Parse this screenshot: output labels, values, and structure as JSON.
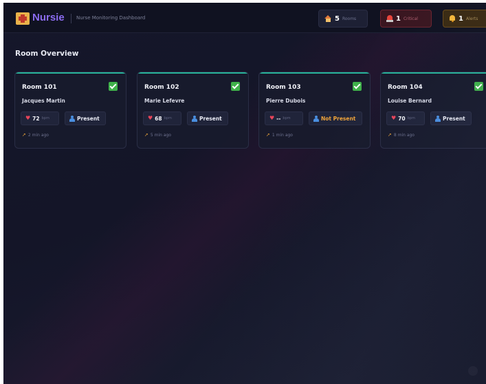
{
  "header": {
    "brand": "Nursie",
    "subtitle": "Nurse Monitoring Dashboard",
    "stats": {
      "rooms": {
        "count": "5",
        "label": "Rooms"
      },
      "critical": {
        "count": "1",
        "label": "Critical"
      },
      "alerts": {
        "count": "1",
        "label": "Alerts"
      }
    }
  },
  "main": {
    "section_title": "Room Overview",
    "rooms": [
      {
        "name": "Room 101",
        "patient": "Jacques Martin",
        "heart_rate": "72",
        "unit": "bpm",
        "presence": "Present",
        "last_seen": "2 min ago"
      },
      {
        "name": "Room 102",
        "patient": "Marie Lefevre",
        "heart_rate": "68",
        "unit": "bpm",
        "presence": "Present",
        "last_seen": "5 min ago"
      },
      {
        "name": "Room 103",
        "patient": "Pierre Dubois",
        "heart_rate": "--",
        "unit": "bpm",
        "presence": "Not Present",
        "last_seen": "1 min ago"
      },
      {
        "name": "Room 104",
        "patient": "Louise Bernard",
        "heart_rate": "70",
        "unit": "bpm",
        "presence": "Present",
        "last_seen": "8 min ago"
      }
    ]
  },
  "colors": {
    "accent": "#8b6cf0",
    "status_ok": "#3fb14a",
    "card_top": "#27b39a",
    "not_present": "#f0a43a",
    "critical": "#e8453c",
    "alert": "#f5b83a"
  },
  "icons": [
    "hospital-icon",
    "house-icon",
    "siren-icon",
    "bell-icon",
    "check-icon",
    "heart-icon",
    "person-icon",
    "walking-icon"
  ]
}
